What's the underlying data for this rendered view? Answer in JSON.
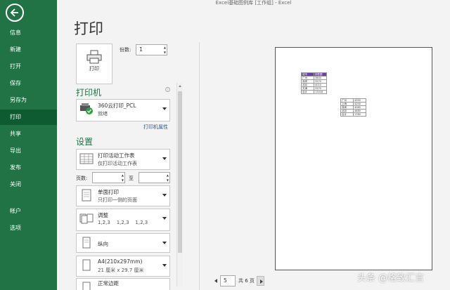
{
  "window": {
    "title": "Excel基础图例库 [工作组] - Excel"
  },
  "sidebar": {
    "items": [
      {
        "label": "信息"
      },
      {
        "label": "新建"
      },
      {
        "label": "打开"
      },
      {
        "label": "保存"
      },
      {
        "label": "另存为"
      },
      {
        "label": "打印"
      },
      {
        "label": "共享"
      },
      {
        "label": "导出"
      },
      {
        "label": "发布"
      },
      {
        "label": "关闭"
      },
      {
        "label": "帐户"
      },
      {
        "label": "选项"
      }
    ],
    "active": "打印",
    "color": "#217346"
  },
  "main": {
    "title": "打印",
    "print_button_label": "打印",
    "copies_label": "份数:",
    "copies_value": "1"
  },
  "printer": {
    "heading": "打印机",
    "name": "360云打印_PCL",
    "status": "就绪",
    "properties_link": "打印机属性"
  },
  "settings": {
    "heading": "设置",
    "print_what": {
      "title": "打印活动工作表",
      "desc": "仅打印活动工作表"
    },
    "pages_label": "页数:",
    "to_label": "至",
    "sides": {
      "title": "单面打印",
      "desc": "只打印一侧的页面"
    },
    "collate": {
      "title": "调整",
      "desc": "1,2,3    1,2,3    1,2,3"
    },
    "orientation": {
      "title": "纵向"
    },
    "paper": {
      "title": "A4(210x297mm)",
      "desc": "21 厘米 x 29.7 厘米"
    },
    "margins": {
      "title": "正常边距"
    }
  },
  "preview": {
    "table1": [
      [
        "城市",
        "销售额"
      ],
      [
        "广州",
        "3800"
      ],
      [
        "深圳",
        "3270"
      ],
      [
        "北京",
        "4010"
      ],
      [
        "天津",
        "3270"
      ],
      [
        "合计",
        "13418"
      ]
    ],
    "table2": [
      [
        "广州",
        "4200"
      ],
      [
        "上海",
        "4200"
      ],
      [
        "深圳",
        "4060"
      ],
      [
        "北京",
        "4680"
      ],
      [
        "合计",
        "1780"
      ]
    ]
  },
  "pager": {
    "current": "5",
    "total": "共 6 页"
  },
  "watermark": "头条 @格致汇言"
}
